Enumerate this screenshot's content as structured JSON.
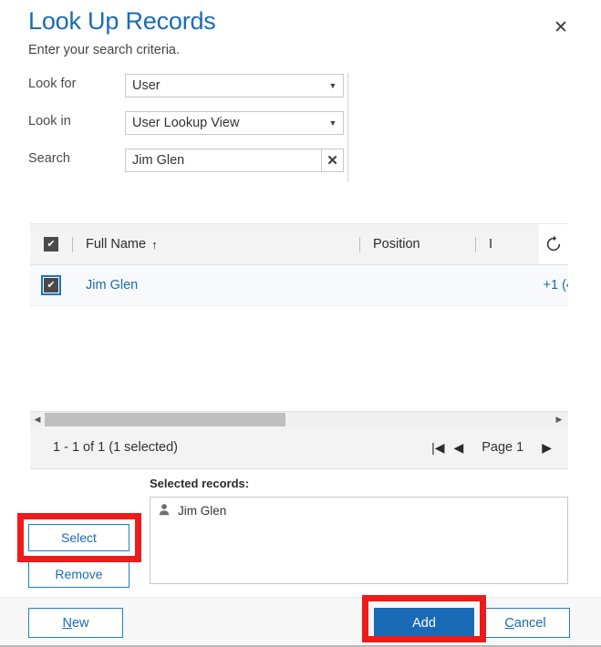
{
  "dialog": {
    "title": "Look Up Records",
    "subtitle": "Enter your search criteria.",
    "close_icon": "close-icon",
    "accent_color": "#1a6bb5",
    "highlight_color": "#ee1b1b"
  },
  "criteria": {
    "look_for": {
      "label": "Look for",
      "value": "User",
      "caret": "▼"
    },
    "look_in": {
      "label": "Look in",
      "value": "User Lookup View",
      "caret": "▼"
    },
    "search": {
      "label": "Search",
      "value": "Jim Glen",
      "placeholder": "",
      "clear_icon": "✕"
    }
  },
  "grid": {
    "header_checkbox_checked": true,
    "check_glyph": "✔",
    "columns": [
      {
        "label": "Full Name",
        "sort": "↑"
      },
      {
        "label": "Position",
        "sort": ""
      }
    ],
    "refresh_icon": "refresh-icon",
    "rows": [
      {
        "checked": true,
        "full_name": "Jim Glen",
        "phone": "+1 (4"
      }
    ],
    "scrollbar": {
      "left_arrow": "◀",
      "right_arrow": "▶"
    },
    "footer": {
      "count_text": "1 - 1 of 1 (1 selected)",
      "first_page_icon": "|◀",
      "prev_page_icon": "◀",
      "page_label": "Page 1",
      "next_page_icon": "▶"
    }
  },
  "selected": {
    "label": "Selected records:",
    "items": [
      {
        "icon": "person-icon",
        "name": "Jim Glen"
      }
    ],
    "select_button": "Select",
    "remove_button": "Remove"
  },
  "footer": {
    "new_button": {
      "accel": "N",
      "rest": "ew"
    },
    "add_button": "Add",
    "cancel_button": {
      "accel": "C",
      "rest": "ancel"
    }
  }
}
